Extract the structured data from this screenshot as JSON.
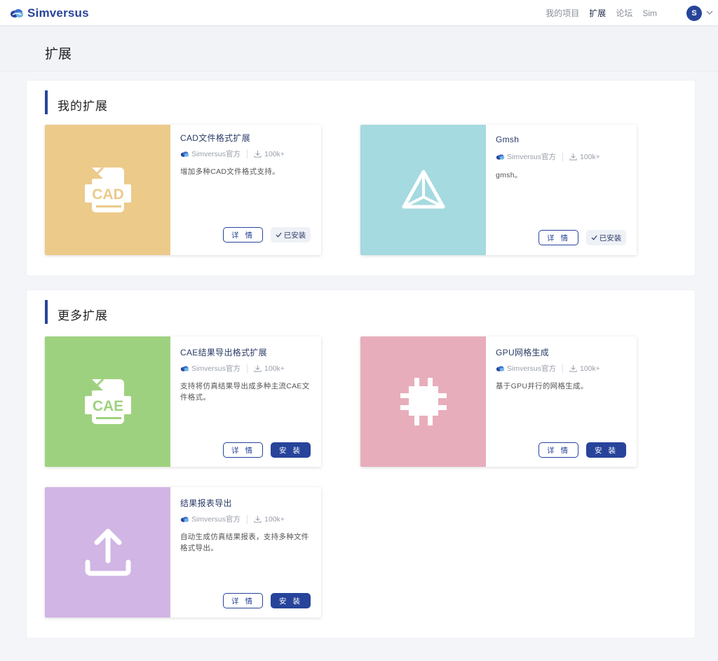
{
  "header": {
    "logo_text": "Simversus",
    "nav": [
      "我的项目",
      "扩展",
      "论坛",
      "Sim"
    ],
    "active_nav": "扩展",
    "avatar_letter": "S"
  },
  "page": {
    "title": "扩展"
  },
  "sections": {
    "mine": {
      "title": "我的扩展"
    },
    "more": {
      "title": "更多扩展"
    }
  },
  "labels": {
    "detail": "详 情",
    "installed": "已安装",
    "install": "安 装"
  },
  "cards": [
    {
      "title": "CAD文件格式扩展",
      "author": "Simversus官方",
      "downloads": "100k+",
      "desc": "增加多种CAD文件格式支持。",
      "thumb_text": "CAD",
      "thumb_color": "#ecca8a",
      "status": "installed"
    },
    {
      "title": "Gmsh",
      "author": "Simversus官方",
      "downloads": "100k+",
      "desc": "gmsh。",
      "thumb_text": "",
      "thumb_color": "#a5dae0",
      "status": "installed"
    },
    {
      "title": "CAE结果导出格式扩展",
      "author": "Simversus官方",
      "downloads": "100k+",
      "desc": "支持将仿真结果导出成多种主流CAE文件格式。",
      "thumb_text": "CAE",
      "thumb_color": "#9ed17f",
      "status": "available"
    },
    {
      "title": "GPU网格生成",
      "author": "Simversus官方",
      "downloads": "100k+",
      "desc": "基于GPU并行的网格生成。",
      "thumb_text": "",
      "thumb_color": "#e8adbb",
      "status": "available"
    },
    {
      "title": "结果报表导出",
      "author": "Simversus官方",
      "downloads": "100k+",
      "desc": "自动生成仿真结果报表，支持多种文件格式导出。",
      "thumb_text": "",
      "thumb_color": "#d1b5e4",
      "status": "available"
    }
  ],
  "icons": {
    "logo": "cloud-logo-icon",
    "cad": "cad-file-icon",
    "gmsh": "pyramid-icon",
    "cae": "cae-file-icon",
    "gpu": "chip-icon",
    "report": "upload-icon"
  },
  "colors": {
    "brand": "#27449a"
  }
}
